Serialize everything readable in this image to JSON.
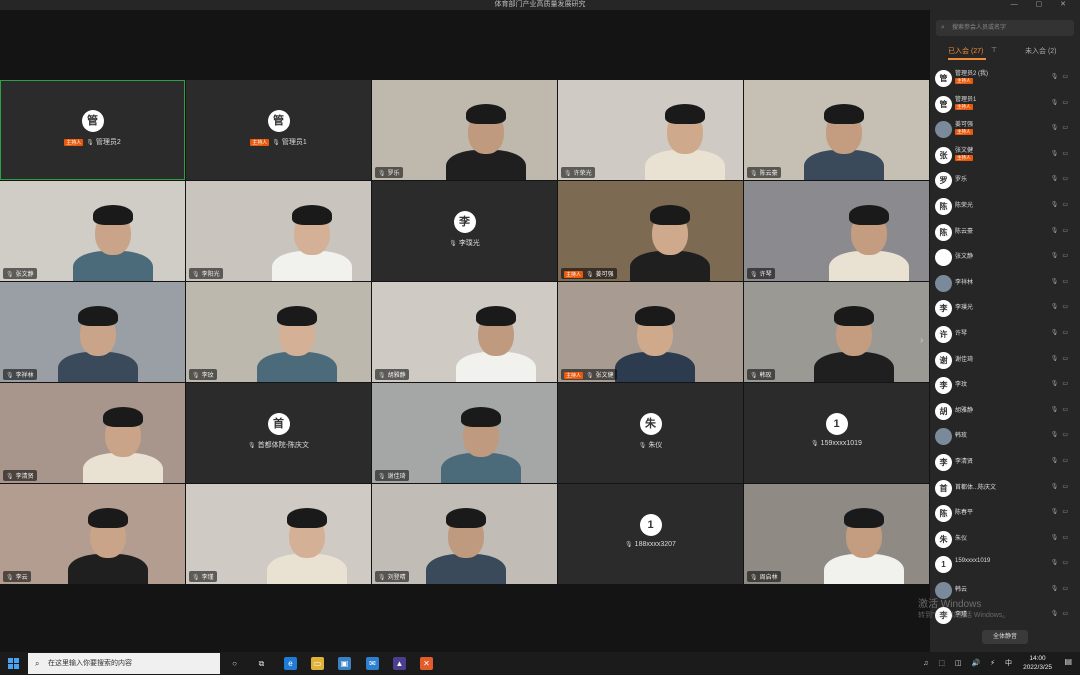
{
  "window": {
    "title": "体育部门产业高质量发展研究",
    "controls": "— ▢ ✕"
  },
  "tiles": [
    {
      "id": "管",
      "kind": "avatar",
      "avatar": "管",
      "name": "管理员2",
      "host": true,
      "host_label": "主持人",
      "active": true
    },
    {
      "id": "管1",
      "kind": "avatar",
      "avatar": "管",
      "name": "管理员1",
      "host": true,
      "host_label": "主持人"
    },
    {
      "kind": "video",
      "name": "罗乐",
      "bg": "#bfb8ad"
    },
    {
      "kind": "video",
      "name": "许荣光",
      "bg": "#cfcac3"
    },
    {
      "kind": "video",
      "name": "陈云豪",
      "bg": "#c6c0b4"
    },
    {
      "kind": "video",
      "name": "张文静",
      "bg": "#d0ccc6"
    },
    {
      "kind": "video",
      "name": "李阳光",
      "bg": "#c9c4bd"
    },
    {
      "kind": "avatar",
      "avatar": "李",
      "name": "李璞光"
    },
    {
      "kind": "video",
      "name": "姜可强",
      "host": true,
      "host_label": "主持人",
      "bg": "#7c6a52"
    },
    {
      "kind": "video",
      "name": "许琴",
      "bg": "#8b8a8f"
    },
    {
      "kind": "video",
      "name": "李祥林",
      "bg": "#9a9fa6"
    },
    {
      "kind": "video",
      "name": "李玟",
      "bg": "#bdb8ae"
    },
    {
      "kind": "video",
      "name": "胡雅静",
      "bg": "#cfcbc4"
    },
    {
      "kind": "video",
      "name": "张文健",
      "host": true,
      "host_label": "主持人",
      "bg": "#a89c92"
    },
    {
      "kind": "video",
      "name": "韩玫",
      "bg": "#9b9993"
    },
    {
      "kind": "video",
      "name": "李清贤",
      "bg": "#a8958b"
    },
    {
      "kind": "avatar",
      "avatar": "首",
      "name": "首都体院-陈庆文"
    },
    {
      "kind": "video",
      "name": "谢佳琦",
      "bg": "#a4a7a5"
    },
    {
      "kind": "avatar",
      "avatar": "朱",
      "name": "朱仪"
    },
    {
      "kind": "avatar",
      "avatar": "1",
      "name": "159xxxx1019"
    },
    {
      "kind": "video",
      "name": "李云",
      "bg": "#b29d90"
    },
    {
      "kind": "video",
      "name": "李瑾",
      "bg": "#cfcbc4"
    },
    {
      "kind": "video",
      "name": "刘登晴",
      "bg": "#c1bcb5"
    },
    {
      "kind": "avatar",
      "avatar": "1",
      "name": "188xxxx3207"
    },
    {
      "kind": "video",
      "name": "周启林",
      "bg": "#8f8b84"
    }
  ],
  "panel": {
    "search_placeholder": "搜索参会人员或名字",
    "tab_in": "已入会 (27)",
    "tab_out": "未入会 (2)",
    "participants": [
      {
        "avatar": "管",
        "name": "管理员2 (我)",
        "badge": "主持人"
      },
      {
        "avatar": "管",
        "name": "管理员1",
        "badge": "主持人"
      },
      {
        "avatar": "",
        "name": "姜可强",
        "badge": "主持人",
        "photo": true
      },
      {
        "avatar": "张",
        "name": "张文健",
        "badge": "主持人"
      },
      {
        "avatar": "罗",
        "name": "罗乐"
      },
      {
        "avatar": "陈",
        "name": "陈荣光"
      },
      {
        "avatar": "陈",
        "name": "陈云豪"
      },
      {
        "avatar": "",
        "name": "张文静"
      },
      {
        "avatar": "",
        "name": "李祥林",
        "photo": true
      },
      {
        "avatar": "李",
        "name": "李璞光"
      },
      {
        "avatar": "许",
        "name": "许琴"
      },
      {
        "avatar": "谢",
        "name": "谢佳琦"
      },
      {
        "avatar": "李",
        "name": "李玟"
      },
      {
        "avatar": "胡",
        "name": "胡雅静"
      },
      {
        "avatar": "",
        "name": "韩玫",
        "photo": true
      },
      {
        "avatar": "李",
        "name": "李清贤"
      },
      {
        "avatar": "首",
        "name": "首都体...陈庆文"
      },
      {
        "avatar": "陈",
        "name": "陈春平"
      },
      {
        "avatar": "朱",
        "name": "朱仪"
      },
      {
        "avatar": "1",
        "name": "159xxxx1019"
      },
      {
        "avatar": "",
        "name": "韩云",
        "photo": true
      },
      {
        "avatar": "李",
        "name": "李瑾"
      }
    ],
    "mute_all": "全体静音",
    "watermark_line1": "激活 Windows",
    "watermark_line2": "转到\"设置\"以激活 Windows。"
  },
  "taskbar": {
    "search_placeholder": "在这里输入你要搜索的内容",
    "tray_icons": "♫ ⬚ ◫ 🔊 ⚡",
    "ime": "中",
    "time": "14:00",
    "date": "2022/3/25"
  }
}
